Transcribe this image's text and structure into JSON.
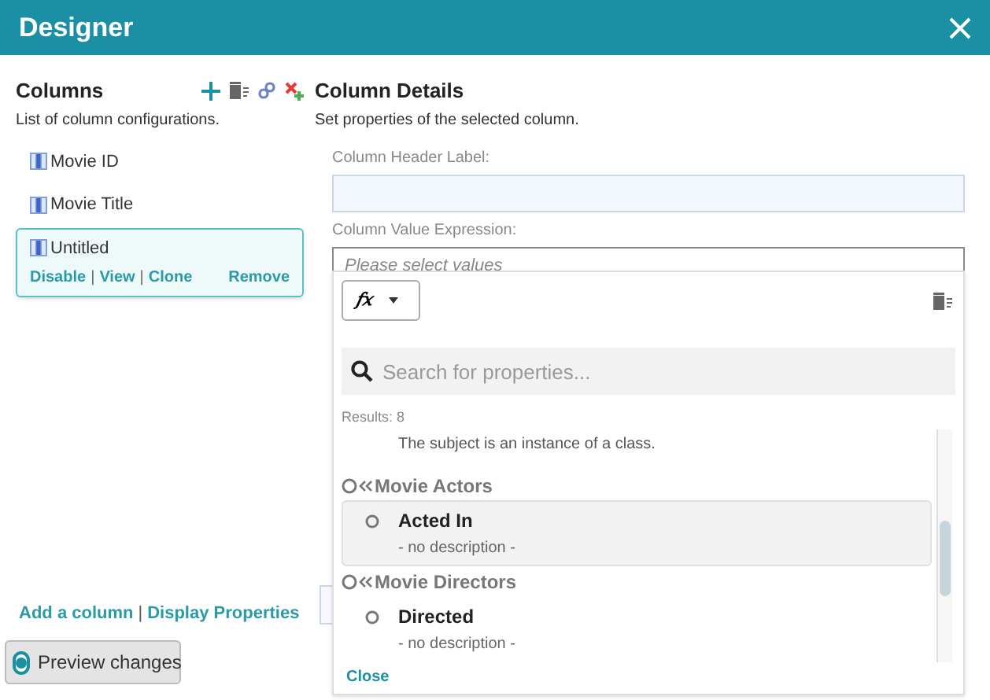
{
  "window": {
    "title": "Designer"
  },
  "columns_panel": {
    "title": "Columns",
    "subtitle": "List of column configurations.",
    "items": [
      {
        "label": "Movie ID",
        "selected": false
      },
      {
        "label": "Movie Title",
        "selected": false
      },
      {
        "label": "Untitled",
        "selected": true,
        "actions": [
          "Disable",
          "View",
          "Clone"
        ],
        "separator": "|",
        "remove": "Remove"
      }
    ],
    "footer_links": [
      "Add a column",
      "Display Properties"
    ],
    "footer_separator": "|",
    "preview": {
      "label": "Preview changes",
      "checked": true
    }
  },
  "details": {
    "title": "Column Details",
    "subtitle": "Set properties of the selected column.",
    "header_label": {
      "label": "Column Header Label:"
    },
    "value_expression": {
      "label": "Column Value Expression:",
      "placeholder": "Please select values"
    }
  },
  "popup": {
    "function_button": "𝑓𝑥",
    "search_placeholder": "Search for properties...",
    "results": "Results: 8",
    "partial_description": "The subject is an instance of a class.",
    "groups": [
      {
        "label": "Movie Actors",
        "items": [
          {
            "label": "Acted In",
            "description": "- no description -",
            "selected": true
          }
        ]
      },
      {
        "label": "Movie Directors",
        "items": [
          {
            "label": "Directed",
            "description": "- no description -",
            "selected": false
          }
        ]
      }
    ],
    "close": "Close"
  }
}
